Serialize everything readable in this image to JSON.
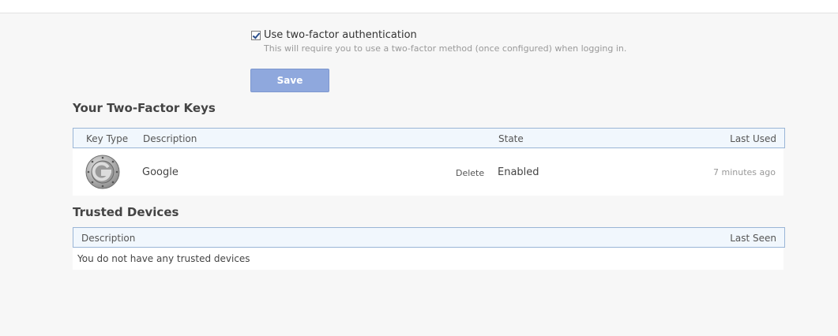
{
  "settings": {
    "two_factor_label": "Use two-factor authentication",
    "two_factor_hint": "This will require you to use a two-factor method (once configured) when logging in.",
    "two_factor_checked": true,
    "save_label": "Save"
  },
  "keys": {
    "title": "Your Two-Factor Keys",
    "columns": {
      "key_type": "Key Type",
      "description": "Description",
      "state": "State",
      "last_used": "Last Used"
    },
    "rows": [
      {
        "icon": "google-authenticator-icon",
        "description": "Google",
        "delete_label": "Delete",
        "state": "Enabled",
        "last_used": "7 minutes ago"
      }
    ]
  },
  "devices": {
    "title": "Trusted Devices",
    "columns": {
      "description": "Description",
      "last_seen": "Last Seen"
    },
    "empty_message": "You do not have any trusted devices"
  },
  "colors": {
    "accent_button": "#8fa8dd",
    "table_border": "#9ab5d6",
    "table_header_bg": "#f1f7fd"
  }
}
